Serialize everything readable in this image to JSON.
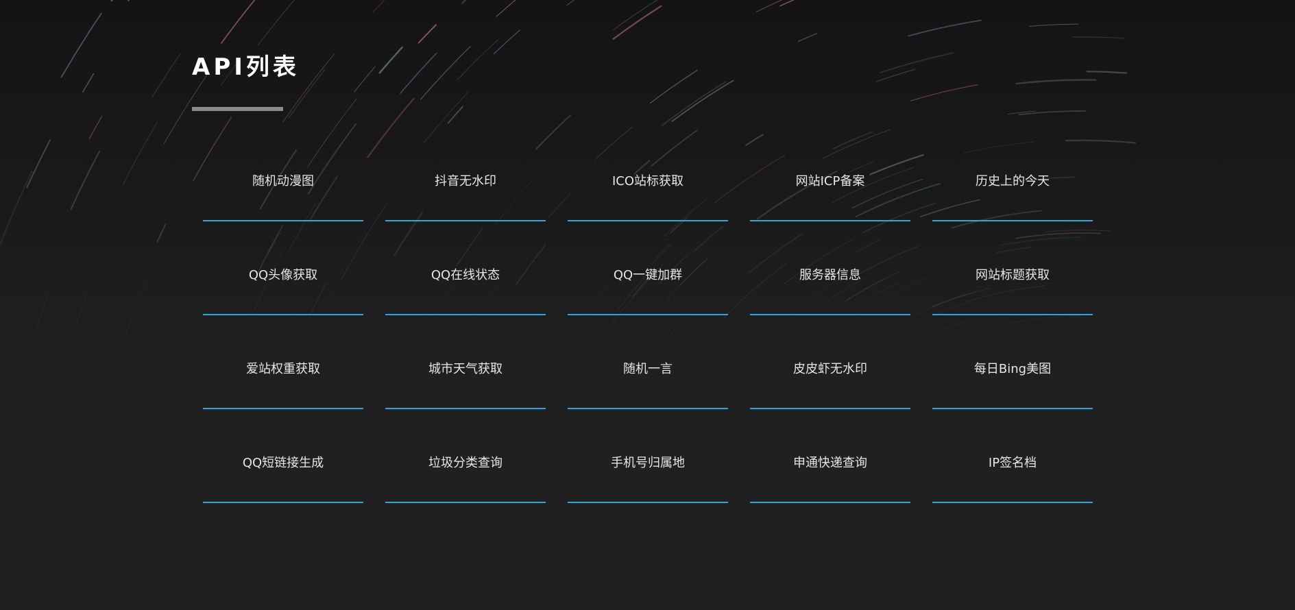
{
  "page": {
    "title": "API列表"
  },
  "theme": {
    "background": "#1f1f1f",
    "accent_underline": "#2aa6e0",
    "title_rule": "#8a8a8a",
    "text": "#e6e6e6"
  },
  "api_list": [
    {
      "label": "随机动漫图"
    },
    {
      "label": "抖音无水印"
    },
    {
      "label": "ICO站标获取"
    },
    {
      "label": "网站ICP备案"
    },
    {
      "label": "历史上的今天"
    },
    {
      "label": "QQ头像获取"
    },
    {
      "label": "QQ在线状态"
    },
    {
      "label": "QQ一键加群"
    },
    {
      "label": "服务器信息"
    },
    {
      "label": "网站标题获取"
    },
    {
      "label": "爱站权重获取"
    },
    {
      "label": "城市天气获取"
    },
    {
      "label": "随机一言"
    },
    {
      "label": "皮皮虾无水印"
    },
    {
      "label": "每日Bing美图"
    },
    {
      "label": "QQ短链接生成"
    },
    {
      "label": "垃圾分类查询"
    },
    {
      "label": "手机号归属地"
    },
    {
      "label": "申通快递查询"
    },
    {
      "label": "IP签名档"
    }
  ]
}
